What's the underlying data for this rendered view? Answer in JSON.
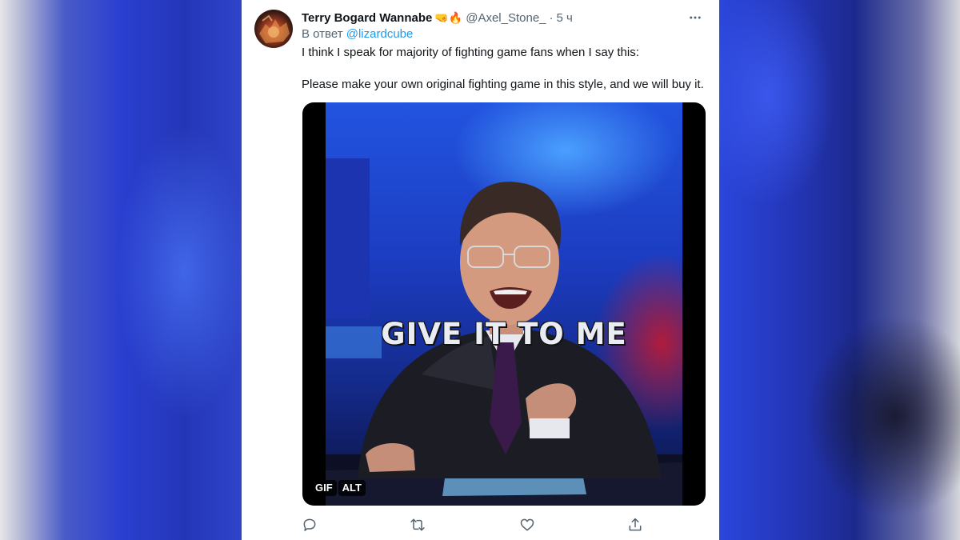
{
  "tweet": {
    "author_name": "Terry Bogard Wannabe",
    "author_emojis": "🤜🔥",
    "handle": "@Axel_Stone_",
    "separator": "·",
    "time": "5 ч",
    "reply_prefix": "В ответ",
    "reply_to": "@lizardcube",
    "text_line_1": "I think I speak for majority of fighting game fans when I say this:",
    "text_line_2": "Please make your own original fighting game in this style, and we will buy it."
  },
  "media": {
    "caption": "GIVE IT TO ME",
    "badge_gif": "GIF",
    "badge_alt": "ALT"
  },
  "actions": {
    "icons": [
      "reply-icon",
      "retweet-icon",
      "like-icon",
      "share-icon"
    ]
  }
}
